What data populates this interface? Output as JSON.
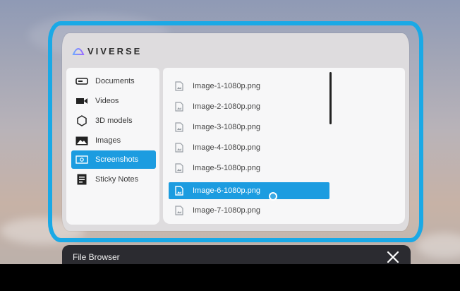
{
  "app": {
    "brand": "VIVERSE",
    "accent": "#1c9ce0"
  },
  "sidebar": {
    "items": [
      {
        "label": "Documents",
        "icon": "document-icon"
      },
      {
        "label": "Videos",
        "icon": "video-camera-icon"
      },
      {
        "label": "3D models",
        "icon": "hexagon-icon"
      },
      {
        "label": "Images",
        "icon": "image-icon"
      },
      {
        "label": "Screenshots",
        "icon": "screenshot-icon",
        "active": true
      },
      {
        "label": "Sticky Notes",
        "icon": "note-icon"
      }
    ]
  },
  "files": {
    "items": [
      {
        "name": "Image-1-1080p.png"
      },
      {
        "name": "Image-2-1080p.png"
      },
      {
        "name": "Image-3-1080p.png"
      },
      {
        "name": "Image-4-1080p.png"
      },
      {
        "name": "Image-5-1080p.png"
      },
      {
        "name": "Image-6-1080p.png",
        "selected": true
      },
      {
        "name": "Image-7-1080p.png"
      }
    ]
  },
  "footer": {
    "title": "File Browser",
    "close_icon": "close-icon"
  }
}
